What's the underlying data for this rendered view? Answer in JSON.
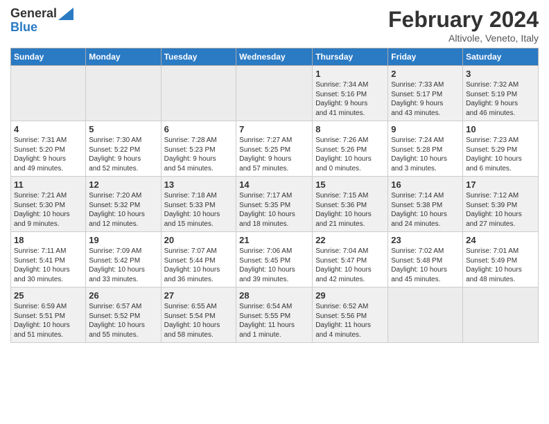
{
  "header": {
    "logo_general": "General",
    "logo_blue": "Blue",
    "month_title": "February 2024",
    "subtitle": "Altivole, Veneto, Italy"
  },
  "weekdays": [
    "Sunday",
    "Monday",
    "Tuesday",
    "Wednesday",
    "Thursday",
    "Friday",
    "Saturday"
  ],
  "weeks": [
    [
      {
        "day": "",
        "info": ""
      },
      {
        "day": "",
        "info": ""
      },
      {
        "day": "",
        "info": ""
      },
      {
        "day": "",
        "info": ""
      },
      {
        "day": "1",
        "info": "Sunrise: 7:34 AM\nSunset: 5:16 PM\nDaylight: 9 hours\nand 41 minutes."
      },
      {
        "day": "2",
        "info": "Sunrise: 7:33 AM\nSunset: 5:17 PM\nDaylight: 9 hours\nand 43 minutes."
      },
      {
        "day": "3",
        "info": "Sunrise: 7:32 AM\nSunset: 5:19 PM\nDaylight: 9 hours\nand 46 minutes."
      }
    ],
    [
      {
        "day": "4",
        "info": "Sunrise: 7:31 AM\nSunset: 5:20 PM\nDaylight: 9 hours\nand 49 minutes."
      },
      {
        "day": "5",
        "info": "Sunrise: 7:30 AM\nSunset: 5:22 PM\nDaylight: 9 hours\nand 52 minutes."
      },
      {
        "day": "6",
        "info": "Sunrise: 7:28 AM\nSunset: 5:23 PM\nDaylight: 9 hours\nand 54 minutes."
      },
      {
        "day": "7",
        "info": "Sunrise: 7:27 AM\nSunset: 5:25 PM\nDaylight: 9 hours\nand 57 minutes."
      },
      {
        "day": "8",
        "info": "Sunrise: 7:26 AM\nSunset: 5:26 PM\nDaylight: 10 hours\nand 0 minutes."
      },
      {
        "day": "9",
        "info": "Sunrise: 7:24 AM\nSunset: 5:28 PM\nDaylight: 10 hours\nand 3 minutes."
      },
      {
        "day": "10",
        "info": "Sunrise: 7:23 AM\nSunset: 5:29 PM\nDaylight: 10 hours\nand 6 minutes."
      }
    ],
    [
      {
        "day": "11",
        "info": "Sunrise: 7:21 AM\nSunset: 5:30 PM\nDaylight: 10 hours\nand 9 minutes."
      },
      {
        "day": "12",
        "info": "Sunrise: 7:20 AM\nSunset: 5:32 PM\nDaylight: 10 hours\nand 12 minutes."
      },
      {
        "day": "13",
        "info": "Sunrise: 7:18 AM\nSunset: 5:33 PM\nDaylight: 10 hours\nand 15 minutes."
      },
      {
        "day": "14",
        "info": "Sunrise: 7:17 AM\nSunset: 5:35 PM\nDaylight: 10 hours\nand 18 minutes."
      },
      {
        "day": "15",
        "info": "Sunrise: 7:15 AM\nSunset: 5:36 PM\nDaylight: 10 hours\nand 21 minutes."
      },
      {
        "day": "16",
        "info": "Sunrise: 7:14 AM\nSunset: 5:38 PM\nDaylight: 10 hours\nand 24 minutes."
      },
      {
        "day": "17",
        "info": "Sunrise: 7:12 AM\nSunset: 5:39 PM\nDaylight: 10 hours\nand 27 minutes."
      }
    ],
    [
      {
        "day": "18",
        "info": "Sunrise: 7:11 AM\nSunset: 5:41 PM\nDaylight: 10 hours\nand 30 minutes."
      },
      {
        "day": "19",
        "info": "Sunrise: 7:09 AM\nSunset: 5:42 PM\nDaylight: 10 hours\nand 33 minutes."
      },
      {
        "day": "20",
        "info": "Sunrise: 7:07 AM\nSunset: 5:44 PM\nDaylight: 10 hours\nand 36 minutes."
      },
      {
        "day": "21",
        "info": "Sunrise: 7:06 AM\nSunset: 5:45 PM\nDaylight: 10 hours\nand 39 minutes."
      },
      {
        "day": "22",
        "info": "Sunrise: 7:04 AM\nSunset: 5:47 PM\nDaylight: 10 hours\nand 42 minutes."
      },
      {
        "day": "23",
        "info": "Sunrise: 7:02 AM\nSunset: 5:48 PM\nDaylight: 10 hours\nand 45 minutes."
      },
      {
        "day": "24",
        "info": "Sunrise: 7:01 AM\nSunset: 5:49 PM\nDaylight: 10 hours\nand 48 minutes."
      }
    ],
    [
      {
        "day": "25",
        "info": "Sunrise: 6:59 AM\nSunset: 5:51 PM\nDaylight: 10 hours\nand 51 minutes."
      },
      {
        "day": "26",
        "info": "Sunrise: 6:57 AM\nSunset: 5:52 PM\nDaylight: 10 hours\nand 55 minutes."
      },
      {
        "day": "27",
        "info": "Sunrise: 6:55 AM\nSunset: 5:54 PM\nDaylight: 10 hours\nand 58 minutes."
      },
      {
        "day": "28",
        "info": "Sunrise: 6:54 AM\nSunset: 5:55 PM\nDaylight: 11 hours\nand 1 minute."
      },
      {
        "day": "29",
        "info": "Sunrise: 6:52 AM\nSunset: 5:56 PM\nDaylight: 11 hours\nand 4 minutes."
      },
      {
        "day": "",
        "info": ""
      },
      {
        "day": "",
        "info": ""
      }
    ]
  ]
}
